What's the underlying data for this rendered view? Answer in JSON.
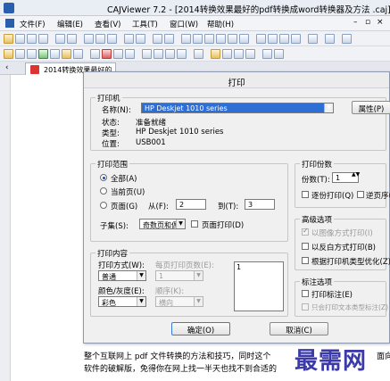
{
  "window": {
    "title": "CAJViewer 7.2 - [2014转换效果最好的pdf转换成word转换器及方法 .caj]"
  },
  "menu": {
    "items": [
      "文件(F)",
      "编辑(E)",
      "查看(V)",
      "工具(T)",
      "窗口(W)",
      "帮助(H)"
    ],
    "minimize": "–",
    "restore": "▫",
    "close": "×"
  },
  "tab": {
    "label": "2014转换效果最好的..."
  },
  "document": {
    "line1": "整个互联网上 pdf 文件转换的方法和技巧，同时这个",
    "line1_end": "面向",
    "line2": "软件的破解版，免得你在网上找一半天也找不到合适的"
  },
  "watermark": {
    "text": "最需网"
  },
  "dialog": {
    "title": "打印",
    "printer": {
      "group_label": "打印机",
      "name_label": "名称(N):",
      "name_value": "HP Deskjet 1010 series",
      "properties_button": "属性(P)",
      "status_label": "状态:",
      "status_value": "准备就绪",
      "type_label": "类型:",
      "type_value": "HP Deskjet 1010 series",
      "location_label": "位置:",
      "location_value": "USB001"
    },
    "range": {
      "group_label": "打印范围",
      "all": "全部(A)",
      "current": "当前页(U)",
      "pages": "页面(G)",
      "from_label": "从(F):",
      "from_value": "2",
      "to_label": "到(T):",
      "to_value": "3",
      "subset_label": "子集(S):",
      "subset_value": "奇数页和偶",
      "reverse": "页面打印(D)"
    },
    "copies": {
      "group_label": "打印份数",
      "count_label": "份数(T):",
      "count_value": "1",
      "collate": "逐份打印(Q)",
      "reverse_order": "逆页序("
    },
    "advanced": {
      "group_label": "高级选项",
      "as_image": "以图像方式打印(I)",
      "auto_rotate": "以反白方式打印(B)",
      "optimize": "根据打印机类型优化(Z)"
    },
    "annotation": {
      "group_label": "标注选项",
      "print_annotation": "打印标注(E)",
      "print_text_only": "只会打印文本类型标注(Z)"
    },
    "content": {
      "group_label": "打印内容",
      "mode_label": "打印方式(W):",
      "mode_value": "普通",
      "pages_per_sheet_label": "每页打印页数(E):",
      "pages_per_sheet_value": "1",
      "color_label": "颜色/灰度(E):",
      "color_value": "彩色",
      "order_label": "顺序(K):",
      "order_value": "横向",
      "preview_value": "1"
    },
    "ok_button": "确定(O)",
    "cancel_button": "取消(C)"
  },
  "colors": {
    "selection": "#2e6fd6",
    "watermark": "#3b3aa8"
  }
}
